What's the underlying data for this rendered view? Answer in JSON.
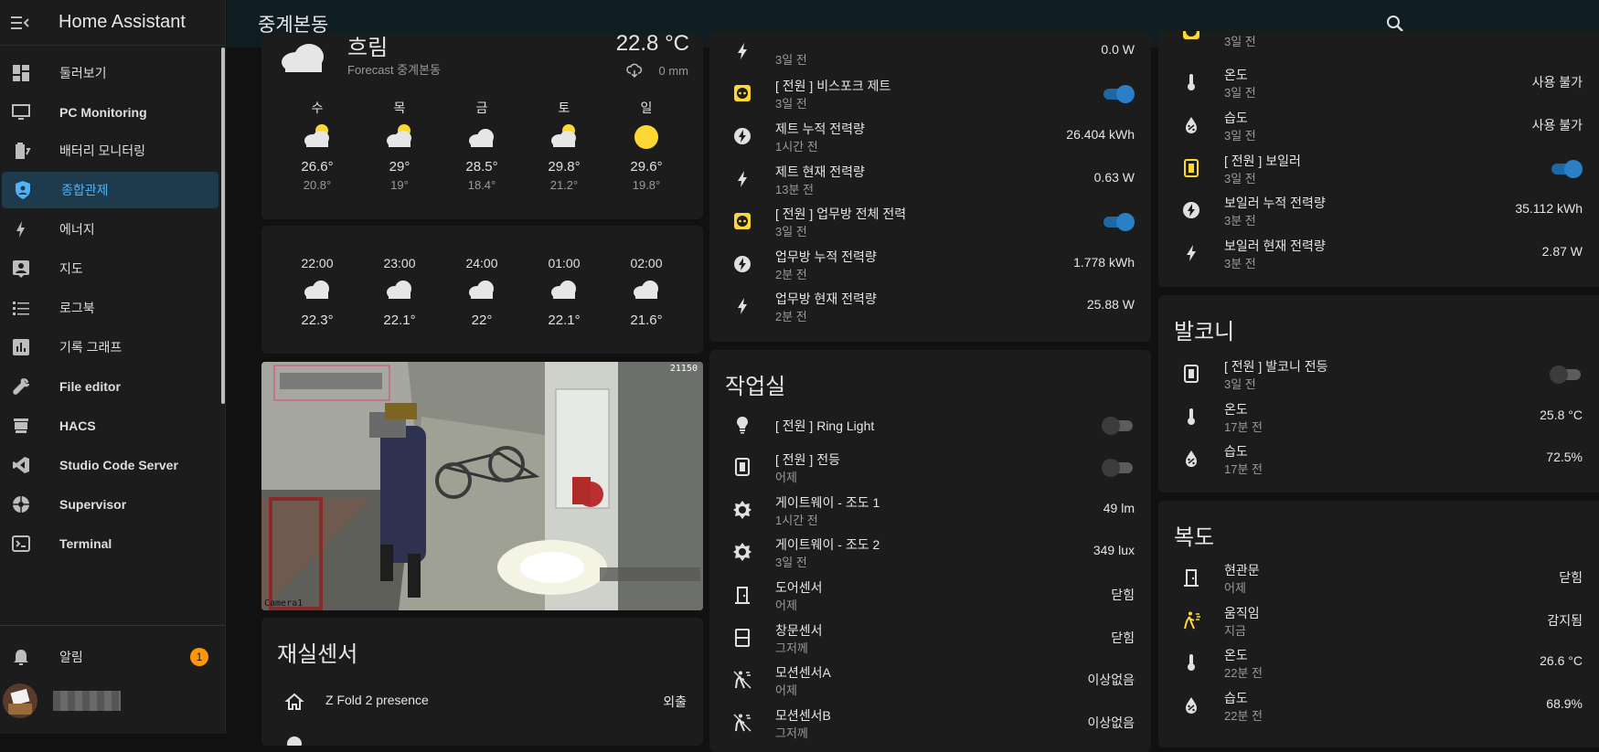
{
  "sidebar": {
    "title": "Home Assistant",
    "items": [
      {
        "label": "둘러보기",
        "icon": "dashboard-icon"
      },
      {
        "label": "PC Monitoring",
        "icon": "monitor-icon"
      },
      {
        "label": "배터리 모니터링",
        "icon": "battery-icon"
      },
      {
        "label": "종합관제",
        "icon": "shield-home-icon"
      },
      {
        "label": "에너지",
        "icon": "lightning-icon"
      },
      {
        "label": "지도",
        "icon": "map-account-icon"
      },
      {
        "label": "로그북",
        "icon": "list-icon"
      },
      {
        "label": "기록 그래프",
        "icon": "chart-box-icon"
      },
      {
        "label": "File editor",
        "icon": "wrench-icon"
      },
      {
        "label": "HACS",
        "icon": "hacs-icon"
      },
      {
        "label": "Studio Code Server",
        "icon": "vscode-icon"
      },
      {
        "label": "Supervisor",
        "icon": "supervisor-icon"
      },
      {
        "label": "Terminal",
        "icon": "terminal-icon"
      }
    ],
    "notifications": {
      "label": "알림",
      "count": "1"
    }
  },
  "topbar": {
    "title": "중계본동"
  },
  "weather": {
    "state": "흐림",
    "temperature": "22.8 °C",
    "forecast_label": "Forecast 중계본동",
    "precipitation": "0 mm",
    "daily": [
      {
        "day": "수",
        "high": "26.6°",
        "low": "20.8°",
        "icon": "partly-cloudy"
      },
      {
        "day": "목",
        "high": "29°",
        "low": "19°",
        "icon": "partly-cloudy"
      },
      {
        "day": "금",
        "high": "28.5°",
        "low": "18.4°",
        "icon": "cloudy"
      },
      {
        "day": "토",
        "high": "29.8°",
        "low": "21.2°",
        "icon": "partly-cloudy"
      },
      {
        "day": "일",
        "high": "29.6°",
        "low": "19.8°",
        "icon": "sunny"
      }
    ],
    "hourly": [
      {
        "time": "22:00",
        "temp": "22.3°"
      },
      {
        "time": "23:00",
        "temp": "22.1°"
      },
      {
        "time": "24:00",
        "temp": "22°"
      },
      {
        "time": "01:00",
        "temp": "22.1°"
      },
      {
        "time": "02:00",
        "temp": "21.6°"
      }
    ]
  },
  "camera": {
    "timestamp": "21150",
    "label": "Camera1"
  },
  "presence": {
    "title": "재실센서",
    "rows": [
      {
        "name": "Z Fold 2 presence",
        "value": "외출"
      }
    ]
  },
  "middle_top": {
    "rows": [
      {
        "name": "",
        "sub": "3일 전",
        "value": "0.0 W",
        "icon": "flash-icon"
      },
      {
        "name": "[ 전원 ] 비스포크 제트",
        "sub": "3일 전",
        "toggle": "on",
        "icon": "power-socket-icon"
      },
      {
        "name": "제트 누적 전력량",
        "sub": "1시간 전",
        "value": "26.404 kWh",
        "icon": "energy-circle-icon"
      },
      {
        "name": "제트 현재 전력량",
        "sub": "13분 전",
        "value": "0.63 W",
        "icon": "flash-icon"
      },
      {
        "name": "[ 전원 ] 업무방 전체 전력",
        "sub": "3일 전",
        "toggle": "on",
        "icon": "power-socket-icon"
      },
      {
        "name": "업무방 누적 전력량",
        "sub": "2분 전",
        "value": "1.778 kWh",
        "icon": "energy-circle-icon"
      },
      {
        "name": "업무방 현재 전력량",
        "sub": "2분 전",
        "value": "25.88 W",
        "icon": "flash-icon"
      }
    ]
  },
  "workroom": {
    "title": "작업실",
    "rows": [
      {
        "name": "[ 전원 ] Ring Light",
        "sub": "",
        "toggle": "off",
        "icon": "lightbulb-icon"
      },
      {
        "name": "[ 전원 ] 전등",
        "sub": "어제",
        "toggle": "off",
        "icon": "light-switch-icon"
      },
      {
        "name": "게이트웨이 - 조도 1",
        "sub": "1시간 전",
        "value": "49 lm",
        "icon": "brightness-icon"
      },
      {
        "name": "게이트웨이 - 조도 2",
        "sub": "3일 전",
        "value": "349 lux",
        "icon": "brightness-icon"
      },
      {
        "name": "도어센서",
        "sub": "어제",
        "value": "닫힘",
        "icon": "door-icon"
      },
      {
        "name": "창문센서",
        "sub": "그저께",
        "value": "닫힘",
        "icon": "window-icon"
      },
      {
        "name": "모션센서A",
        "sub": "어제",
        "value": "이상없음",
        "icon": "motion-off-icon"
      },
      {
        "name": "모션센서B",
        "sub": "그저께",
        "value": "이상없음",
        "icon": "motion-off-icon"
      }
    ]
  },
  "right_top": {
    "rows": [
      {
        "name": "",
        "sub": "3일 전",
        "value": "",
        "icon": "power-socket-icon"
      },
      {
        "name": "온도",
        "sub": "3일 전",
        "value": "사용 불가",
        "icon": "thermometer-icon"
      },
      {
        "name": "습도",
        "sub": "3일 전",
        "value": "사용 불가",
        "icon": "water-percent-icon"
      },
      {
        "name": "[ 전원 ] 보일러",
        "sub": "3일 전",
        "toggle": "on",
        "icon": "light-switch-icon"
      },
      {
        "name": "보일러 누적 전력량",
        "sub": "3분 전",
        "value": "35.112 kWh",
        "icon": "energy-circle-icon"
      },
      {
        "name": "보일러 현재 전력량",
        "sub": "3분 전",
        "value": "2.87 W",
        "icon": "flash-icon"
      }
    ]
  },
  "balcony": {
    "title": "발코니",
    "rows": [
      {
        "name": "[ 전원 ] 발코니 전등",
        "sub": "3일 전",
        "toggle": "off",
        "icon": "light-switch-icon"
      },
      {
        "name": "온도",
        "sub": "17분 전",
        "value": "25.8 °C",
        "icon": "thermometer-icon"
      },
      {
        "name": "습도",
        "sub": "17분 전",
        "value": "72.5%",
        "icon": "water-percent-icon"
      }
    ]
  },
  "hallway": {
    "title": "복도",
    "rows": [
      {
        "name": "현관문",
        "sub": "어제",
        "value": "닫힘",
        "icon": "door-icon"
      },
      {
        "name": "움직임",
        "sub": "지금",
        "value": "감지됨",
        "icon": "motion-icon"
      },
      {
        "name": "온도",
        "sub": "22분 전",
        "value": "26.6 °C",
        "icon": "thermometer-icon"
      },
      {
        "name": "습도",
        "sub": "22분 전",
        "value": "68.9%",
        "icon": "water-percent-icon"
      }
    ]
  },
  "colors": {
    "accent": "#4fb3f6",
    "toggle_on": "#2a7fc6",
    "icon_yellow": "#fdd835",
    "background": "#111111",
    "card": "#1c1c1c"
  }
}
